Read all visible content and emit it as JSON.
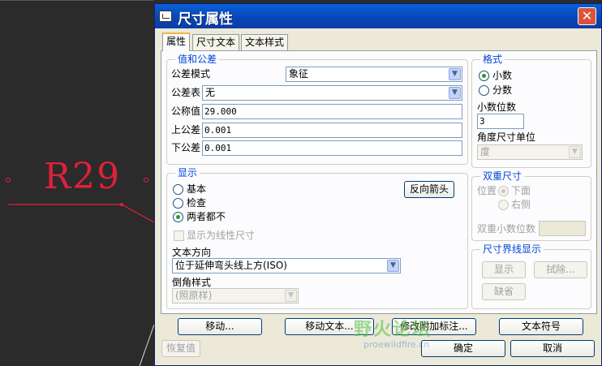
{
  "cad": {
    "label": "R29"
  },
  "dialog": {
    "title": "尺寸属性",
    "close_label": "✕",
    "tabs": [
      {
        "label": "属性",
        "active": true
      },
      {
        "label": "尺寸文本",
        "active": false
      },
      {
        "label": "文本样式",
        "active": false
      }
    ],
    "value_tolerance": {
      "title": "值和公差",
      "tolerance_mode_label": "公差模式",
      "tolerance_mode_value": "象征",
      "tolerance_table_label": "公差表",
      "tolerance_table_value": "无",
      "nominal_label": "公称值",
      "nominal_value": "29.000",
      "upper_label": "上公差",
      "upper_value": "0.001",
      "lower_label": "下公差",
      "lower_value": "0.001"
    },
    "display": {
      "title": "显示",
      "options": [
        "基本",
        "检查",
        "两者都不"
      ],
      "selected": "两者都不",
      "flip_arrows_label": "反向箭头",
      "linear_checkbox_label": "显示为线性尺寸",
      "text_direction_label": "文本方向",
      "text_direction_value": "位于延伸弯头线上方(ISO)",
      "chamfer_label": "倒角样式",
      "chamfer_value": "(照原样)"
    },
    "format": {
      "title": "格式",
      "options": [
        "小数",
        "分数"
      ],
      "selected": "小数",
      "decimal_places_label": "小数位数",
      "decimal_places_value": "3",
      "angle_unit_label": "角度尺寸单位",
      "angle_unit_value": "度"
    },
    "dual": {
      "title": "双重尺寸",
      "position_label": "位置",
      "options": [
        "下面",
        "右侧"
      ],
      "selected": "下面",
      "dual_decimals_label": "双重小数位数"
    },
    "witness": {
      "title": "尺寸界线显示",
      "show_label": "显示",
      "erase_label": "拭除...",
      "default_label": "缺省"
    },
    "buttons": {
      "move": "移动...",
      "move_text": "移动文本...",
      "modify_attach": "修改附加标注...",
      "text_symbol": "文本符号",
      "restore": "恢复值",
      "ok": "确定",
      "cancel": "取消"
    }
  },
  "watermark": {
    "text": "野火论坛",
    "url": "proewildfire.cn"
  }
}
